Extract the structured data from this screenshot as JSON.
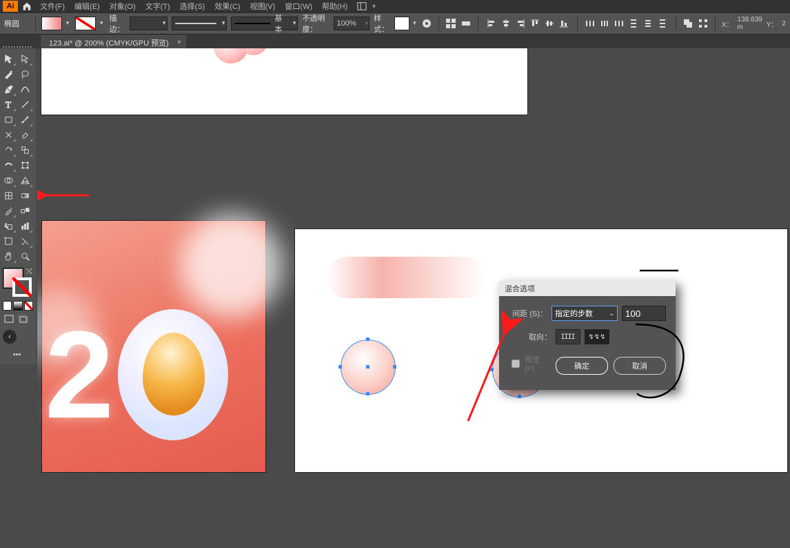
{
  "window": {
    "active_tool": "椭圆"
  },
  "menubar": {
    "items": [
      "文件(F)",
      "编辑(E)",
      "对象(O)",
      "文字(T)",
      "选择(S)",
      "效果(C)",
      "视图(V)",
      "窗口(W)",
      "帮助(H)"
    ]
  },
  "optionsbar": {
    "stroke_label": "描边：",
    "stroke_weight": "",
    "stroke_style_label": "基本",
    "opacity_label": "不透明度：",
    "opacity_value": "100%",
    "style_label": "样式：",
    "coord_x_label": "X：",
    "coord_x": "138.639 m",
    "coord_y_label": "Y：",
    "coord_y": "2"
  },
  "tab": {
    "title": "123.ai* @ 200% (CMYK/GPU 预览)",
    "close": "×"
  },
  "dialog": {
    "title": "混合选项",
    "spacing_label": "间距 (S)：",
    "spacing_mode": "指定的步数",
    "spacing_value": "100",
    "orientation_label": "取向：",
    "preview_label": "预览 (P)",
    "ok": "确定",
    "cancel": "取消"
  },
  "tools": {
    "left_col": [
      "selection",
      "pen",
      "type",
      "line",
      "rectangle",
      "brush",
      "rotate",
      "width",
      "freeform",
      "mesh",
      "eyedropper",
      "slice",
      "column-graph",
      "artboard",
      "hand"
    ],
    "right_col": [
      "direct-selection",
      "curvature",
      "touch-type",
      "arc",
      "ellipse",
      "pencil",
      "scale",
      "warp",
      "perspective",
      "gradient",
      "color-picker",
      "blend",
      "bar-graph",
      "print-tiling",
      "zoom"
    ]
  },
  "canvas": {
    "number_text_2": "2",
    "selection_handles": true
  }
}
